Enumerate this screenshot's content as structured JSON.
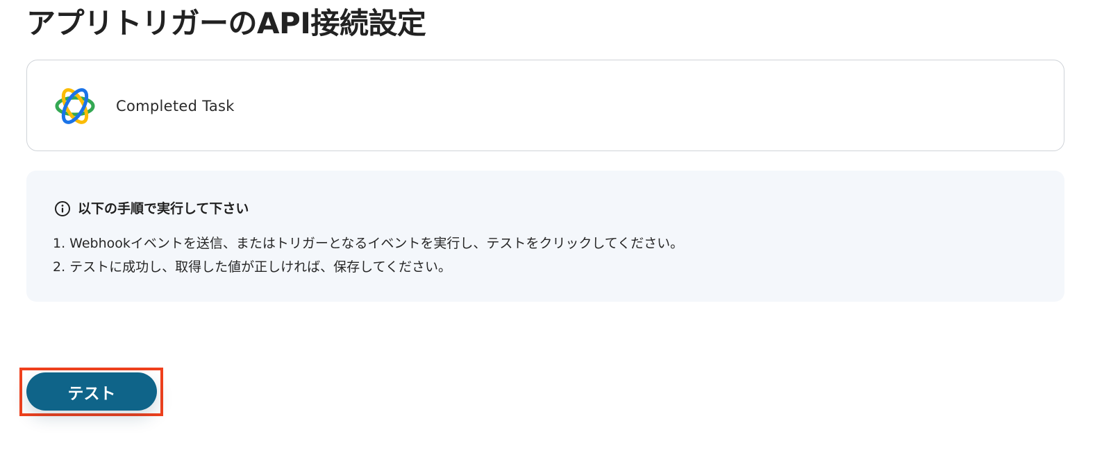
{
  "page": {
    "title": "アプリトリガーのAPI接続設定"
  },
  "trigger_card": {
    "app_icon": "app-logo-icon",
    "event_name": "Completed Task"
  },
  "instructions": {
    "icon": "info-icon",
    "title": "以下の手順で実行して下さい",
    "steps": [
      "1. Webhookイベントを送信、またはトリガーとなるイベントを実行し、テストをクリックしてください。",
      "2. テストに成功し、取得した値が正しければ、保存してください。"
    ]
  },
  "actions": {
    "test_label": "テスト"
  },
  "colors": {
    "primary_button": "#0f6489",
    "highlight_outline": "#f0401c",
    "info_background": "#f4f7fb",
    "card_border": "#cfd3d8"
  }
}
